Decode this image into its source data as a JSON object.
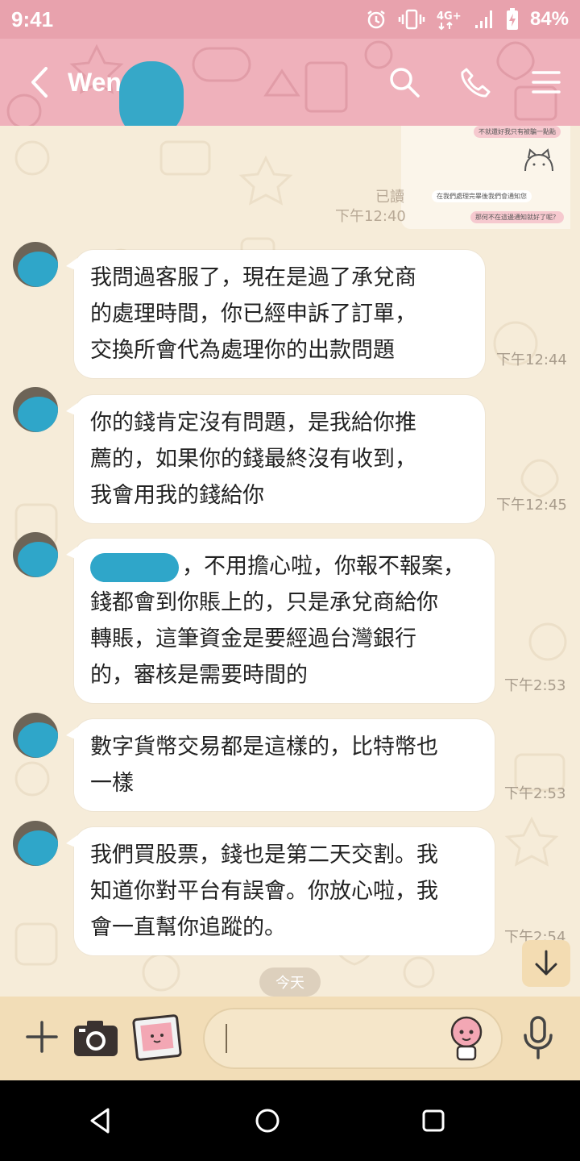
{
  "status_bar": {
    "time": "9:41",
    "network": "4G+",
    "battery": "84%"
  },
  "header": {
    "contact_name": "Wen"
  },
  "chat": {
    "thumbnail_lines": [
      "不就還好我只有被騙一點點",
      "在我們處理完畢後我們會通知您",
      "那何不在這邊通知就好了呢？"
    ],
    "read_label": "已讀",
    "read_time": "下午12:40",
    "messages": [
      {
        "lines": [
          "我問過客服了，現在是過了承兌商",
          "的處理時間，你已經申訴了訂單，",
          "交換所會代為處理你的出款問題"
        ],
        "time": "下午12:44"
      },
      {
        "lines": [
          "你的錢肯定沒有問題，是我給你推",
          "薦的，如果你的錢最終沒有收到，",
          "我會用我的錢給你"
        ],
        "time": "下午12:45"
      },
      {
        "lines": [
          "，不用擔心啦，你報不報案，",
          "錢都會到你賬上的，只是承兌商給你",
          "轉賬，這筆資金是要經過台灣銀行",
          "的，審核是需要時間的"
        ],
        "time": "下午2:53"
      },
      {
        "lines": [
          "數字貨幣交易都是這樣的，比特幣也",
          "一樣"
        ],
        "time": "下午2:53"
      },
      {
        "lines": [
          "我們買股票，錢也是第二天交割。我",
          "知道你對平台有誤會。你放心啦，我",
          "會一直幫你追蹤的。"
        ],
        "time": "下午2:54"
      }
    ],
    "date_divider": "今天"
  },
  "colors": {
    "status_bar": "#e8a2ad",
    "header": "#efb1bb",
    "chat_bg": "#f6ecd9",
    "input_bar": "#f2ddb7",
    "bubble": "#ffffff",
    "redaction": "#2fa6c9"
  }
}
